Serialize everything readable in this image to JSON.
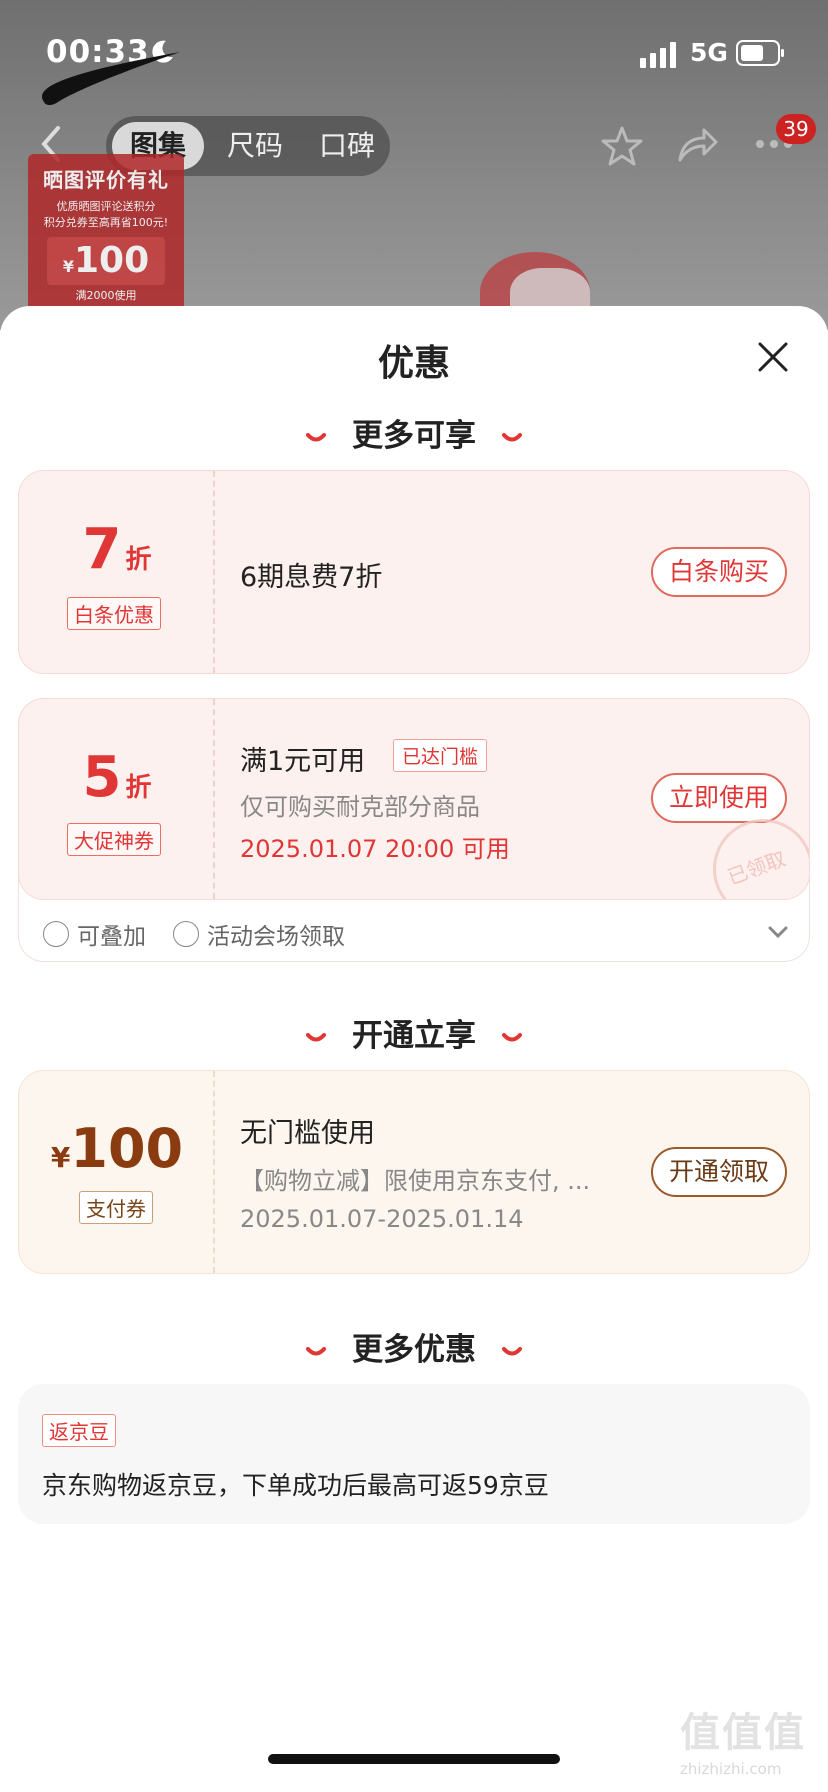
{
  "status_bar": {
    "time": "00:33",
    "network": "5G"
  },
  "nav": {
    "tabs": [
      "图集",
      "尺码",
      "口碑"
    ],
    "active_tab": 0,
    "cart_badge": "39"
  },
  "background_promo": {
    "title": "晒图评价有礼",
    "line1": "优质晒图评论送积分",
    "line2": "积分兑券至高再省100元!",
    "amount_prefix": "¥",
    "amount": "100",
    "condition": "满2000使用"
  },
  "sheet": {
    "title": "优惠"
  },
  "sections": {
    "more_enjoy": "更多可享",
    "open_enjoy": "开通立享",
    "more_discounts": "更多优惠"
  },
  "baitiao_card": {
    "number": "7",
    "unit": "折",
    "tag": "白条优惠",
    "text": "6期息费7折",
    "button": "白条购买"
  },
  "promo_coupon": {
    "number": "5",
    "unit": "折",
    "tag": "大促神券",
    "title": "满1元可用",
    "reached_tag": "已达门槛",
    "desc": "仅可购买耐克部分商品",
    "time": "2025.01.07 20:00 可用",
    "button": "立即使用",
    "stamp": "已领取",
    "footer_stackable": "可叠加",
    "footer_source": "活动会场领取"
  },
  "pay_coupon": {
    "currency": "¥",
    "amount": "100",
    "tag": "支付券",
    "title": "无门槛使用",
    "desc": "【购物立减】限使用京东支付, ...",
    "period": "2025.01.07-2025.01.14",
    "button": "开通领取"
  },
  "jd_beans": {
    "tag": "返京豆",
    "text": "京东购物返京豆，下单成功后最高可返59京豆"
  },
  "watermark": {
    "text": "值值值",
    "url": "zhizhizhi.com"
  },
  "colors": {
    "accent_red": "#e03636",
    "gold_brown": "#8a3c10"
  }
}
